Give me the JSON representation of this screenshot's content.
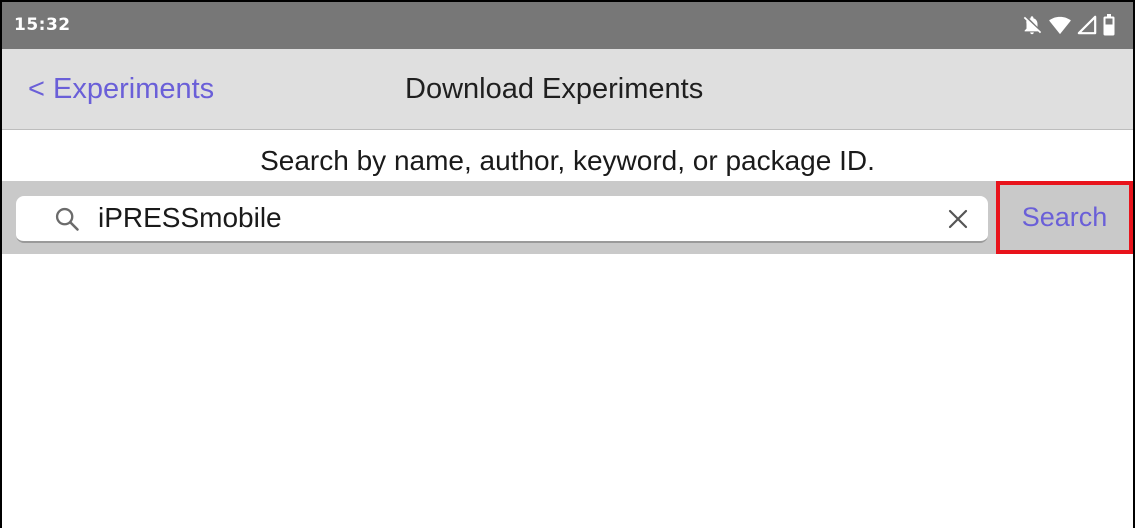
{
  "status_bar": {
    "time": "15:32",
    "icons": [
      "bell-off-icon",
      "wifi-icon",
      "signal-icon",
      "battery-icon"
    ]
  },
  "nav": {
    "back_label": "< Experiments",
    "title": "Download Experiments"
  },
  "search": {
    "hint": "Search by name, author, keyword, or package ID.",
    "value": "iPRESSmobile",
    "button_label": "Search"
  },
  "colors": {
    "accent": "#6a5fd8",
    "highlight": "#e8131b",
    "status_bar": "#777777",
    "nav_bar": "#dfdfdf",
    "search_band": "#c9c9c9"
  }
}
